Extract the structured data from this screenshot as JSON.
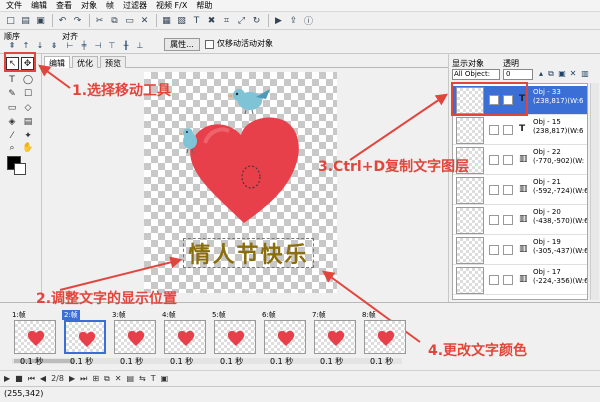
{
  "menu": [
    "文件",
    "编辑",
    "查看",
    "对象",
    "帧",
    "过滤器",
    "视频 F/X",
    "帮助"
  ],
  "order_bar": {
    "order_label": "顺序",
    "arrange_label": "对齐",
    "attr_button": "属性...",
    "only_move_label": "仅移动活动对象"
  },
  "tabs": [
    "编辑",
    "优化",
    "预览"
  ],
  "canvas": {
    "text": "情人节快乐"
  },
  "right_panel": {
    "display_label": "显示对象",
    "transparency_label": "透明",
    "object_filter": "All Object:",
    "transparency_value": "0",
    "objects": [
      {
        "name": "Obj - 33",
        "coords": "(238,817)",
        "mode": "(W:6",
        "type": "T",
        "selected": true
      },
      {
        "name": "Obj - 15",
        "coords": "(238,817)",
        "mode": "(W:6",
        "type": "T",
        "selected": false
      },
      {
        "name": "Obj - 22",
        "coords": "(-770,-902)",
        "mode": "(W:",
        "type": "▥",
        "selected": false
      },
      {
        "name": "Obj - 21",
        "coords": "(-592,-724)",
        "mode": "(W:6",
        "type": "▥",
        "selected": false
      },
      {
        "name": "Obj - 20",
        "coords": "(-438,-570)",
        "mode": "(W:6",
        "type": "▥",
        "selected": false
      },
      {
        "name": "Obj - 19",
        "coords": "(-305,-437)",
        "mode": "(W:6",
        "type": "▥",
        "selected": false
      },
      {
        "name": "Obj - 17",
        "coords": "(-224,-356)",
        "mode": "(W:6",
        "type": "▥",
        "selected": false
      }
    ]
  },
  "frames": [
    {
      "label": "1:帧",
      "time": "0.1 秒",
      "selected": false
    },
    {
      "label": "2:帧",
      "time": "0.1 秒",
      "selected": true
    },
    {
      "label": "3:帧",
      "time": "0.1 秒",
      "selected": false
    },
    {
      "label": "4:帧",
      "time": "0.1 秒",
      "selected": false
    },
    {
      "label": "5:帧",
      "time": "0.1 秒",
      "selected": false
    },
    {
      "label": "6:帧",
      "time": "0.1 秒",
      "selected": false
    },
    {
      "label": "7:帧",
      "time": "0.1 秒",
      "selected": false
    },
    {
      "label": "8:帧",
      "time": "0.1 秒",
      "selected": false
    }
  ],
  "bottom": {
    "frame_counter": "2/8"
  },
  "status": {
    "coords": "(255,342)"
  },
  "annotations": {
    "step1": "1.选择移动工具",
    "step2": "2.调整文字的显示位置",
    "step3": "3.Ctrl+D复制文字图层",
    "step4": "4.更改文字颜色"
  },
  "colors": {
    "annotation_red": "#e2453c",
    "heart_red": "#e8404a",
    "text_gold": "#8a6d0c",
    "selection_blue": "#3b6fd6"
  }
}
